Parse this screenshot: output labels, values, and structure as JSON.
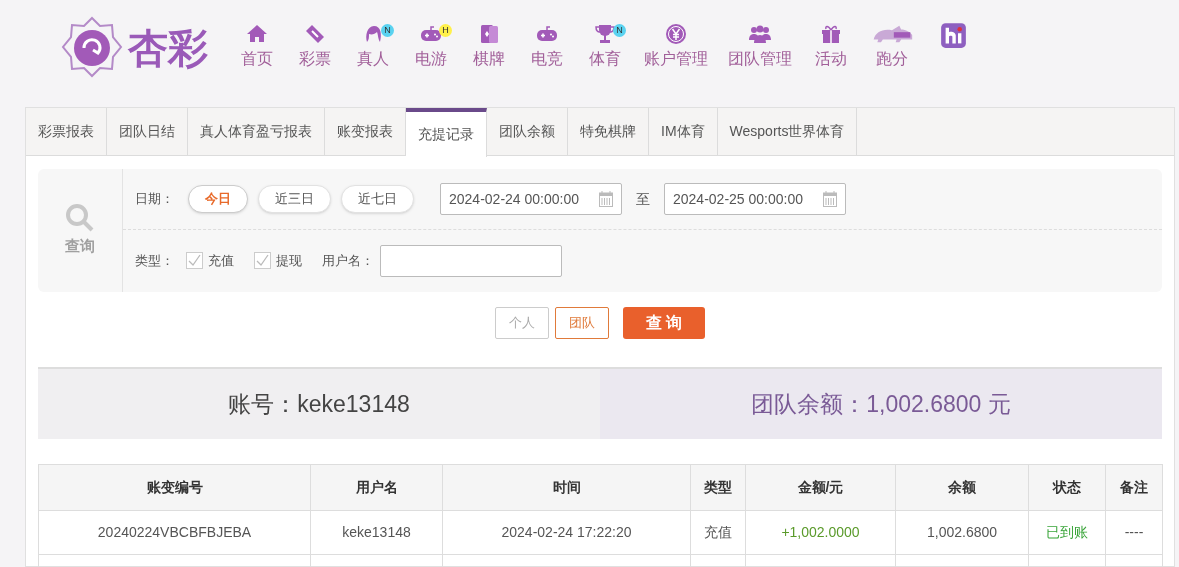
{
  "logo": {
    "text": "杏彩"
  },
  "nav": [
    {
      "label": "首页"
    },
    {
      "label": "彩票"
    },
    {
      "label": "真人",
      "badge": "N",
      "color": "#5ad2f0"
    },
    {
      "label": "电游",
      "badge": "H",
      "color": "#fff04a"
    },
    {
      "label": "棋牌"
    },
    {
      "label": "电竞"
    },
    {
      "label": "体育",
      "badge": "N",
      "color": "#5ad2f0"
    },
    {
      "label": "账户管理"
    },
    {
      "label": "团队管理"
    },
    {
      "label": "活动"
    },
    {
      "label": "跑分"
    },
    {
      "kind": "icon_only"
    }
  ],
  "tabs": [
    {
      "label": "彩票报表",
      "selected": false
    },
    {
      "label": "团队日结",
      "selected": false
    },
    {
      "label": "真人体育盈亏报表",
      "selected": false
    },
    {
      "label": "账变报表",
      "selected": false
    },
    {
      "label": "充提记录",
      "selected": true
    },
    {
      "label": "团队余额",
      "selected": false
    },
    {
      "label": "特免棋牌",
      "selected": false
    },
    {
      "label": "IM体育",
      "selected": false
    },
    {
      "label": "Wesports世界体育",
      "selected": false
    }
  ],
  "filter": {
    "search_label": "查询",
    "date_label": "日期：",
    "ranges": [
      {
        "label": "今日",
        "selected": true
      },
      {
        "label": "近三日",
        "selected": false
      },
      {
        "label": "近七日",
        "selected": false
      }
    ],
    "start": "2024-02-24 00:00:00",
    "to": "至",
    "end": "2024-02-25 00:00:00",
    "type_label": "类型：",
    "types": [
      {
        "label": "充值",
        "checked": true
      },
      {
        "label": "提现",
        "checked": true
      }
    ],
    "user_label": "用户名："
  },
  "scope": [
    {
      "label": "个人",
      "selected": false
    },
    {
      "label": "团队",
      "selected": true
    }
  ],
  "query_button": "查 询",
  "summary": {
    "account": "账号：keke13148",
    "balance": "团队余额：1,002.6800 元"
  },
  "table": {
    "columns": [
      "账变编号",
      "用户名",
      "时间",
      "类型",
      "金额/元",
      "余额",
      "状态",
      "备注"
    ],
    "rows": [
      [
        "20240224VBCBFBJEBA",
        "keke13148",
        "2024-02-24 17:22:20",
        "充值",
        "+1,002.0000",
        "1,002.6800",
        "已到账",
        "----"
      ]
    ]
  }
}
